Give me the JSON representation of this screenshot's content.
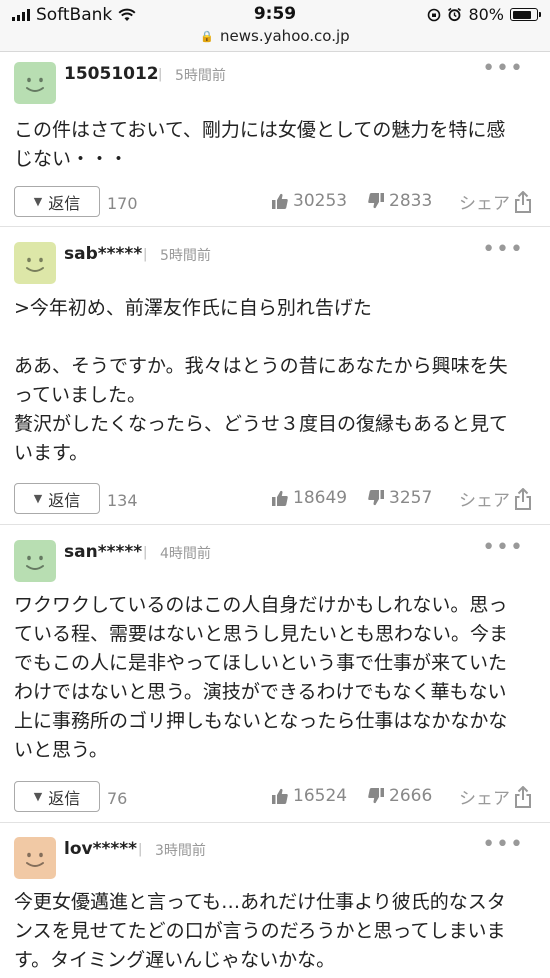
{
  "status_bar": {
    "carrier": "SoftBank",
    "time": "9:59",
    "battery": "80%",
    "battery_level": 0.8,
    "url": "news.yahoo.co.jp"
  },
  "comments": [
    {
      "username": "15051012",
      "time": "5時間前",
      "text": "この件はさておいて、剛力には女優としての魅力を特に感\nじない・・・",
      "reply_label": "返信",
      "reply_count": "170",
      "likes": "30253",
      "dislikes": "2833",
      "share_label": "シェア",
      "avatar_color": "#b8deb2"
    },
    {
      "username": "sab*****",
      "time": "5時間前",
      "text": ">今年初め、前澤友作氏に自ら別れ告げた\n\nああ、そうですか。我々はとうの昔にあなたから興味を失\nっていました。\n贅沢がしたくなったら、どうせ３度目の復縁もあると見て\nいます。",
      "reply_label": "返信",
      "reply_count": "134",
      "likes": "18649",
      "dislikes": "3257",
      "share_label": "シェア",
      "avatar_color": "#dde7a8"
    },
    {
      "username": "san*****",
      "time": "4時間前",
      "text": "ワクワクしているのはこの人自身だけかもしれない。思っ\nている程、需要はないと思うし見たいとも思わない。今ま\nでもこの人に是非やってほしいという事で仕事が来ていた\nわけではないと思う。演技ができるわけでもなく華もない\n上に事務所のゴリ押しもないとなったら仕事はなかなかな\nいと思う。",
      "reply_label": "返信",
      "reply_count": "76",
      "likes": "16524",
      "dislikes": "2666",
      "share_label": "シェア",
      "avatar_color": "#b8deb2"
    },
    {
      "username": "lov*****",
      "time": "3時間前",
      "text": "今更女優邁進と言っても…あれだけ仕事より彼氏的なスタ\nンスを見せてたどの口が言うのだろうかと思ってしまいま\nす。タイミング遅いんじゃないかな。",
      "avatar_color": "#f1c9a5"
    }
  ]
}
